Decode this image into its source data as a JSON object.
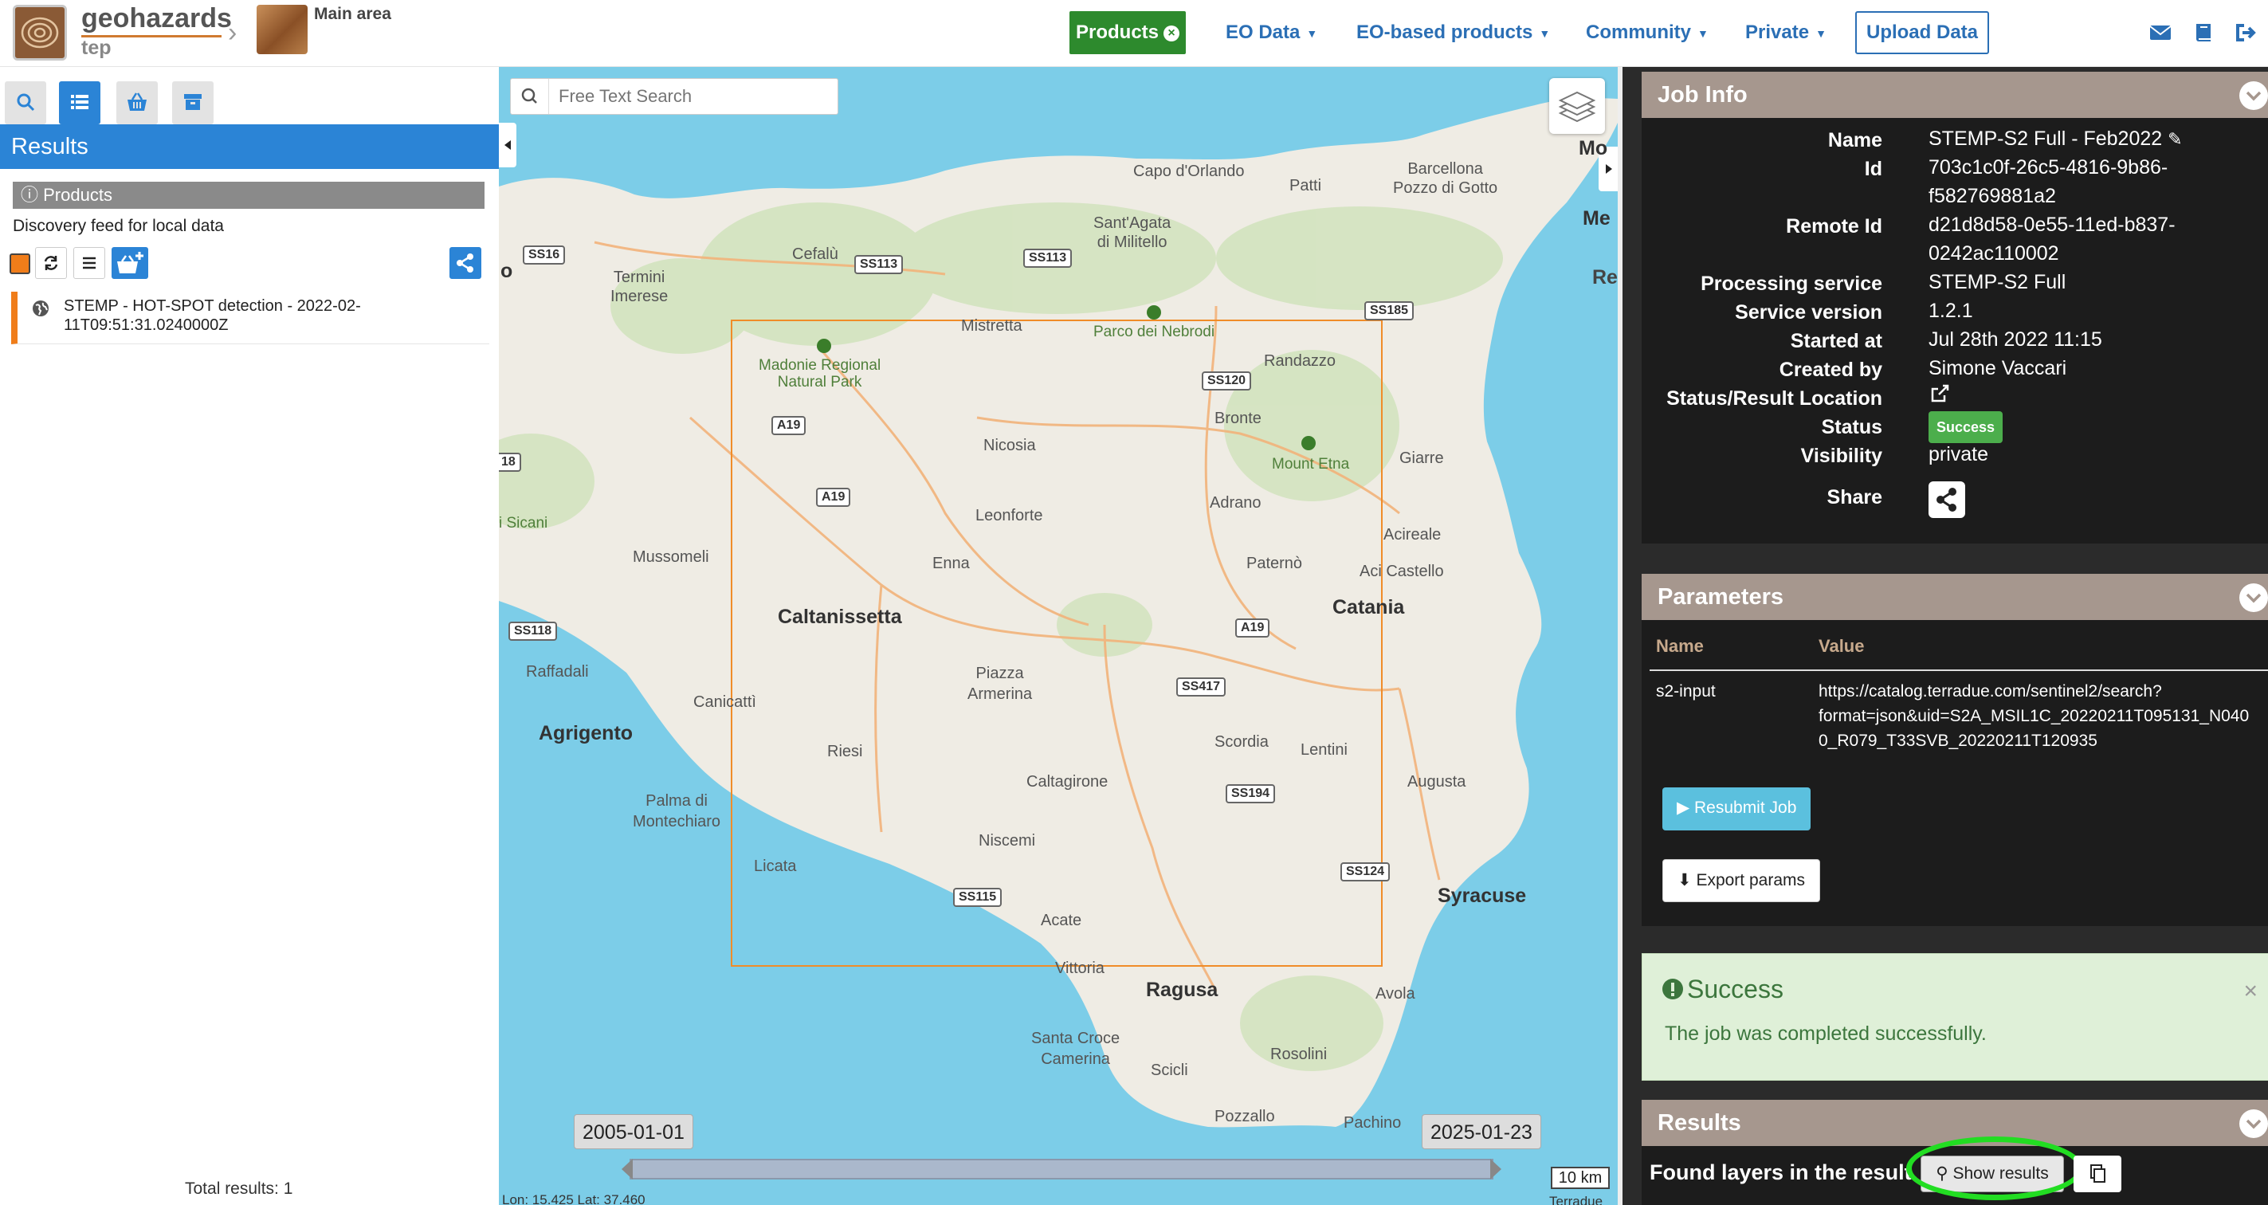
{
  "header": {
    "brand_name": "geohazards",
    "brand_sub": "tep",
    "area_name": "Main area",
    "nav": [
      {
        "label": "Products"
      },
      {
        "label": "EO Data"
      },
      {
        "label": "EO-based products"
      },
      {
        "label": "Community"
      },
      {
        "label": "Private"
      }
    ],
    "upload_label": "Upload Data",
    "icons": [
      "envelope-icon",
      "book-icon",
      "sign-out-icon"
    ]
  },
  "left_panel": {
    "tabs": [
      "search-icon",
      "list-icon",
      "basket-icon",
      "archive-icon"
    ],
    "results_title": "Results",
    "products_header": "Products",
    "feed_description": "Discovery feed for local data",
    "result_items": [
      {
        "title": "STEMP - HOT-SPOT detection - 2022-02-11T09:51:31.0240000Z"
      }
    ],
    "total_results": "Total results: 1"
  },
  "map": {
    "search_placeholder": "Free Text Search",
    "date_start": "2005-01-01",
    "date_end": "2025-01-23",
    "scale_label": "10 km",
    "coords_text": "Lon: 15.425 Lat: 37.460",
    "attribution": "Terradue",
    "labels": {
      "palermo_partial": "Mo",
      "capo": "Capo d'Orlando",
      "patti": "Patti",
      "barcellona": "Barcellona\nPozzo di Gotto",
      "cefalu": "Cefalù",
      "santagata": "Sant'Agata\ndi Militello",
      "termini": "Termini\nImerese",
      "mistretta": "Mistretta",
      "nebrodi": "Parco dei Nebrodi",
      "madonie": "Madonie Regional\nNatural Park",
      "randazzo": "Randazzo",
      "bronte": "Bronte",
      "etna": "Mount Etna",
      "giarre": "Giarre",
      "nicosia": "Nicosia",
      "sicani": "i Sicani",
      "leonforte": "Leonforte",
      "adrano": "Adrano",
      "mussomeli": "Mussomeli",
      "enna": "Enna",
      "paterno": "Paternò",
      "acireale": "Acireale",
      "acicastello": "Aci Castello",
      "caltanissetta": "Caltanissetta",
      "catania": "Catania",
      "raffadali": "Raffadali",
      "piazza": "Piazza\nArmerina",
      "canicatti": "Canicattì",
      "agrigento": "Agrigento",
      "riesi": "Riesi",
      "scordia": "Scordia",
      "lentini": "Lentini",
      "caltagirone": "Caltagirone",
      "augusta": "Augusta",
      "palma": "Palma di\nMontechiaro",
      "niscemi": "Niscemi",
      "licata": "Licata",
      "acate": "Acate",
      "syracuse": "Syracuse",
      "vittoria": "Vittoria",
      "ragusa": "Ragusa",
      "avola": "Avola",
      "santacroce": "Santa Croce\nCamerina",
      "rosolini": "Rosolini",
      "scicli": "Scicli",
      "pozzallo": "Pozzallo",
      "pachino": "Pachino",
      "messina_partial": "Me",
      "reggio_partial": "Re",
      "o_partial": "o"
    },
    "roads": [
      "SS16",
      "SS113",
      "SS113",
      "SS185",
      "SS120",
      "A19",
      "A19",
      "SS118",
      "A19",
      "SS417",
      "SS194",
      "SS115",
      "SS124",
      "18"
    ]
  },
  "job_info": {
    "title": "Job Info",
    "fields": [
      {
        "key": "Name",
        "value": "STEMP-S2 Full - Feb2022"
      },
      {
        "key": "Id",
        "value": "703c1c0f-26c5-4816-9b86-",
        "value2": "f582769881a2"
      },
      {
        "key": "Remote Id",
        "value": "d21d8d58-0e55-11ed-b837-",
        "value2": "0242ac110002"
      },
      {
        "key": "Processing service",
        "value": "STEMP-S2 Full"
      },
      {
        "key": "Service version",
        "value": "1.2.1"
      },
      {
        "key": "Started at",
        "value": "Jul 28th 2022 11:15"
      },
      {
        "key": "Created by",
        "value": "Simone Vaccari"
      },
      {
        "key": "Status/Result Location",
        "value": ""
      },
      {
        "key": "Status",
        "value": "Success"
      },
      {
        "key": "Visibility",
        "value": "private"
      },
      {
        "key": "Share",
        "value": ""
      }
    ]
  },
  "parameters": {
    "title": "Parameters",
    "col_name": "Name",
    "col_value": "Value",
    "rows": [
      {
        "name": "s2-input",
        "value_lines": [
          "https://catalog.terradue.com/sentinel2/search?",
          "format=json&uid=S2A_MSIL1C_20220211T095131_N040",
          "0_R079_T33SVB_20220211T120935"
        ]
      }
    ],
    "resubmit_label": "Resubmit Job",
    "export_label": "Export params"
  },
  "alert": {
    "title": "Success",
    "message": "The job was completed successfully.",
    "close": "×"
  },
  "results": {
    "title": "Results",
    "found_text": "Found layers in the result.",
    "show_results_label": "Show results"
  },
  "colors": {
    "accent_blue": "#2b84d6",
    "products_green": "#2d8a2d",
    "result_orange": "#f07d1a",
    "panel_header": "#a6978e",
    "success_green": "#4cae4c",
    "highlight": "#22dd22"
  }
}
